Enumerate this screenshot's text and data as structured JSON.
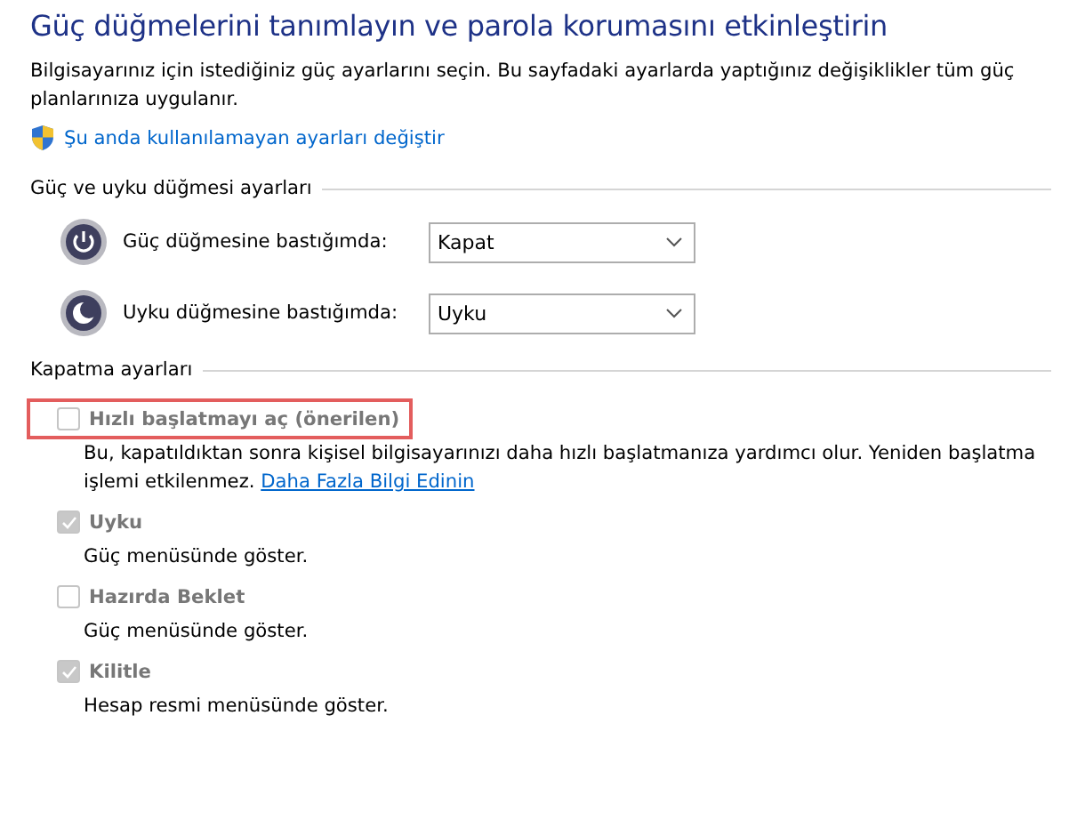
{
  "title": "Güç düğmelerini tanımlayın ve parola korumasını etkinleştirin",
  "intro": "Bilgisayarınız için istediğiniz güç ayarlarını seçin. Bu sayfadaki ayarlarda yaptığınız değişiklikler tüm güç planlarınıza uygulanır.",
  "admin_link": "Şu anda kullanılamayan ayarları değiştir",
  "button_section": {
    "heading": "Güç ve uyku düğmesi ayarları",
    "rows": [
      {
        "kind": "power",
        "label": "Güç düğmesine bastığımda:",
        "value": "Kapat"
      },
      {
        "kind": "sleep",
        "label": "Uyku düğmesine bastığımda:",
        "value": "Uyku"
      }
    ]
  },
  "shutdown_section": {
    "heading": "Kapatma ayarları",
    "options": [
      {
        "label": "Hızlı başlatmayı aç (önerilen)",
        "checked": false,
        "disabled": true,
        "highlighted": true,
        "description": "Bu, kapatıldıktan sonra kişisel bilgisayarınızı daha hızlı başlatmanıza yardımcı olur. Yeniden başlatma işlemi etkilenmez.",
        "link": "Daha Fazla Bilgi Edinin"
      },
      {
        "label": "Uyku",
        "checked": true,
        "disabled": true,
        "highlighted": false,
        "description": "Güç menüsünde göster."
      },
      {
        "label": "Hazırda Beklet",
        "checked": false,
        "disabled": true,
        "highlighted": false,
        "description": "Güç menüsünde göster."
      },
      {
        "label": "Kilitle",
        "checked": true,
        "disabled": true,
        "highlighted": false,
        "description": "Hesap resmi menüsünde göster."
      }
    ]
  }
}
